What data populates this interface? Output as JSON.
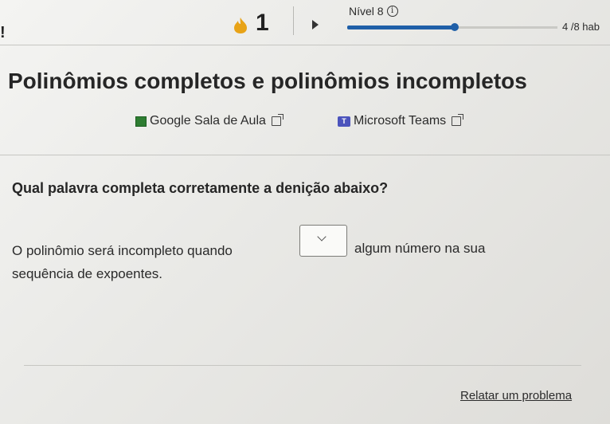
{
  "header": {
    "left_mark": "!",
    "streak_count": "1",
    "level_label": "Nível 8",
    "level_progress": 0.51,
    "skill_count": "4 /8 hab"
  },
  "lesson": {
    "title": "Polinômios completos e polinômios incompletos",
    "share": {
      "classroom_label": "Google Sala de Aula",
      "teams_label": "Microsoft Teams"
    }
  },
  "question": {
    "prompt": "Qual palavra completa corretamente a denição abaixo?",
    "sentence_before": "O polinômio será incompleto quando",
    "sentence_after": "algum número na sua",
    "sentence_end": "sequência de expoentes.",
    "blank_value": ""
  },
  "footer": {
    "report_label": "Relatar um problema"
  },
  "colors": {
    "progress": "#1f5fa8",
    "flame": "#e8a317"
  },
  "icons": [
    "flame-icon",
    "play-icon",
    "info-icon",
    "classroom-icon",
    "teams-icon",
    "external-link-icon",
    "chevron-down-icon"
  ]
}
